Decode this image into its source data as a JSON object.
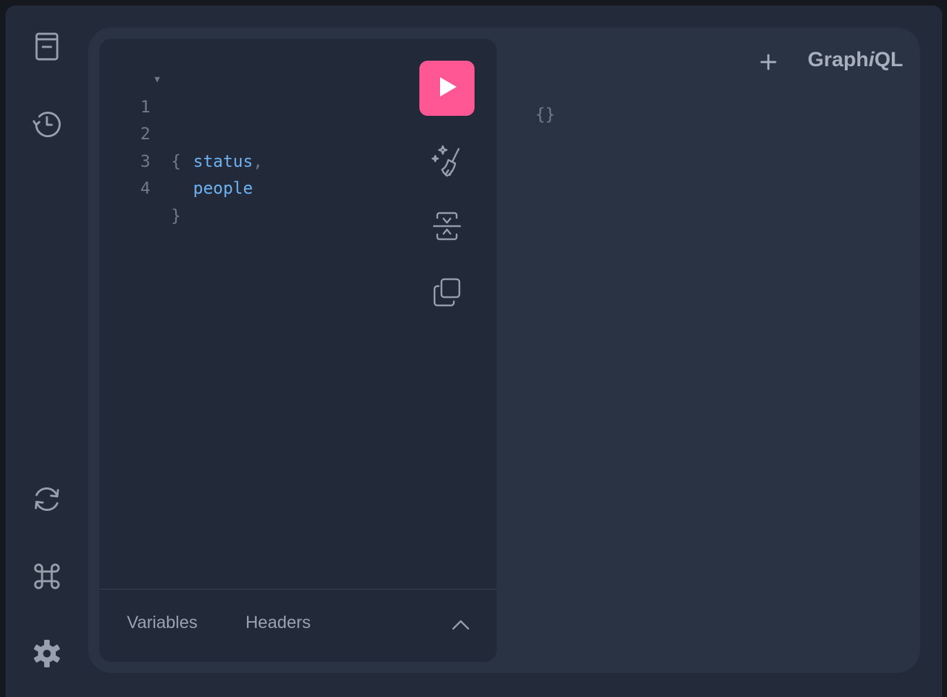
{
  "app": {
    "title_prefix": "Graph",
    "title_italic": "i",
    "title_suffix": "QL"
  },
  "sidebar": {
    "top_items": [
      {
        "icon": "docs-icon",
        "label": "Show Documentation Explorer"
      },
      {
        "icon": "history-icon",
        "label": "Show History"
      }
    ],
    "bottom_items": [
      {
        "icon": "refetch-icon",
        "label": "Re-fetch GraphQL schema"
      },
      {
        "icon": "command-icon",
        "label": "Open short keys dialog"
      },
      {
        "icon": "gear-icon",
        "label": "Open settings dialog"
      }
    ]
  },
  "editor": {
    "lines": [
      {
        "num": "1",
        "text": "{"
      },
      {
        "num": "2",
        "field": "status",
        "punct": ","
      },
      {
        "num": "3",
        "field": "people",
        "punct": ""
      },
      {
        "num": "4",
        "text": "}"
      }
    ],
    "toolbar": {
      "run_icon": "play-icon",
      "prettify_icon": "prettify-icon",
      "merge_icon": "merge-fragments-icon",
      "copy_icon": "copy-icon"
    },
    "footer": {
      "variables_tab": "Variables",
      "headers_tab": "Headers",
      "toggle_icon": "chevron-up-icon"
    }
  },
  "tabs": {
    "add_icon": "plus-icon"
  },
  "result": {
    "text": "{}"
  },
  "colors": {
    "accent": "#ff5794",
    "field": "#6fb1ef",
    "background": "#232b3a",
    "editor_bg": "#222a3a",
    "panel_bg": "#2a3344"
  }
}
